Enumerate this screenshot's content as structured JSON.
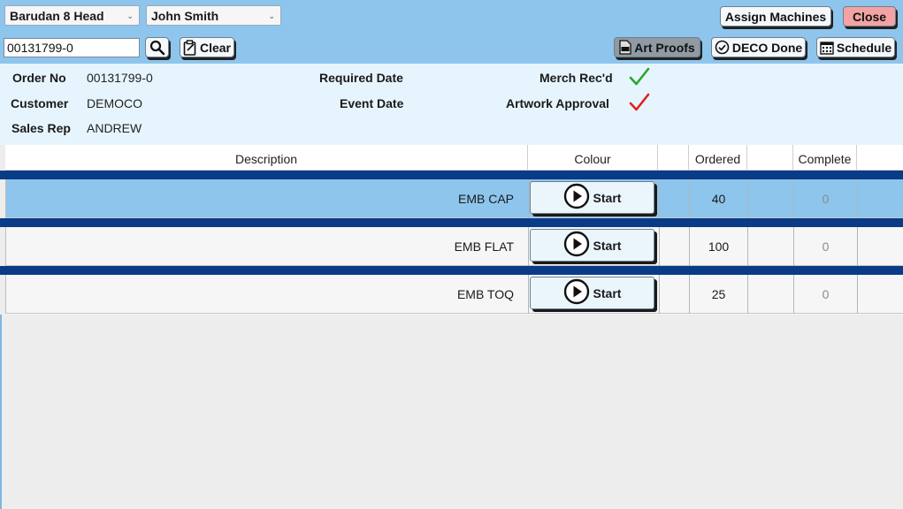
{
  "toolbar": {
    "machine_select": "Barudan 8 Head",
    "user_select": "John Smith",
    "assign_machines": "Assign Machines",
    "close": "Close",
    "search_value": "00131799-0",
    "clear": "Clear",
    "art_proofs": "Art Proofs",
    "deco_done": "DECO Done",
    "schedule": "Schedule"
  },
  "info": {
    "order_no_label": "Order No",
    "order_no": "00131799-0",
    "customer_label": "Customer",
    "customer": "DEMOCO",
    "sales_rep_label": "Sales Rep",
    "sales_rep": "ANDREW",
    "required_date_label": "Required Date",
    "event_date_label": "Event Date",
    "merch_recd_label": "Merch Rec'd",
    "merch_recd_status": "ok",
    "artwork_approval_label": "Artwork Approval",
    "artwork_approval_status": "pending"
  },
  "table": {
    "headers": {
      "description": "Description",
      "colour": "Colour",
      "ordered": "Ordered",
      "complete": "Complete"
    },
    "start_label": "Start",
    "rows": [
      {
        "description": "EMB CAP",
        "ordered": "40",
        "complete": "0",
        "selected": true
      },
      {
        "description": "EMB FLAT",
        "ordered": "100",
        "complete": "0",
        "selected": false
      },
      {
        "description": "EMB TOQ",
        "ordered": "25",
        "complete": "0",
        "selected": false
      }
    ]
  },
  "colors": {
    "toolbar_bg": "#8ec5ec",
    "info_bg": "#e6f5fd",
    "separator": "#0a3b87",
    "close_button": "#f3a3a3",
    "check_green": "#2aa52a",
    "check_red": "#e02020"
  },
  "icons": {
    "search": "magnifier-icon",
    "clear": "clipboard-icon",
    "art_proofs": "pdf-file-icon",
    "deco_done": "check-circle-icon",
    "schedule": "calendar-icon",
    "start": "play-circle-icon"
  }
}
